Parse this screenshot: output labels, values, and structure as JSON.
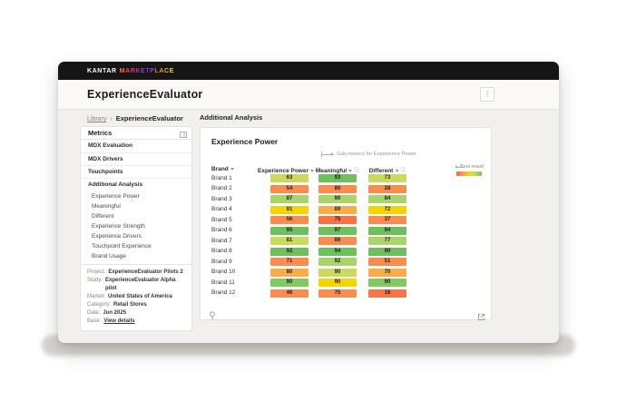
{
  "header": {
    "logo_kantar": "KANTAR",
    "logo_marketplace": "MARKETPLACE",
    "marketplace_letter_colors": [
      "#ff7033",
      "#fc4d3d",
      "#f1297c",
      "#cb2fa4",
      "#9c3ccd",
      "#6f46d8",
      "#8e44c8",
      "#e2772f",
      "#f1961f",
      "#f7b513",
      "#fcd305"
    ],
    "app_title": "ExperienceEvaluator"
  },
  "breadcrumb": {
    "library": "Library",
    "separator": "›",
    "current": "ExperienceEvaluator"
  },
  "section_title": "Additional Analysis",
  "sidebar": {
    "title": "Metrics",
    "items": [
      "MDX Evaluation",
      "MDX Drivers",
      "Touchpoints",
      "Additional Analysis"
    ],
    "active_item": "Additional Analysis",
    "sub_items": [
      "Experience Power",
      "Meaningful",
      "Different",
      "Experience Strength",
      "Experience Drivers",
      "Touchpoint Experience",
      "Brand Usage"
    ]
  },
  "project_info": [
    {
      "label": "Project:",
      "value": "ExperienceEvaluator Pilots 2",
      "is_link": false
    },
    {
      "label": "Study:",
      "value": "ExperienceEvaluator Alpha pilot",
      "is_link": false
    },
    {
      "label": "Market:",
      "value": "United States of America",
      "is_link": false
    },
    {
      "label": "Category:",
      "value": "Retail Stores",
      "is_link": false
    },
    {
      "label": "Date:",
      "value": "Jun 2025",
      "is_link": false
    },
    {
      "label": "Base:",
      "value": "View details",
      "is_link": true
    }
  ],
  "card": {
    "title": "Experience Power",
    "note": "Sub-metrics for Experience Power",
    "legend_label": "Best result",
    "menu_icon": "kebab-menu",
    "info_icon_glyph": "ⓘ"
  },
  "chart_data": {
    "type": "heatmap",
    "columns": [
      {
        "label": "Brand",
        "sortable": true,
        "info": false
      },
      {
        "label": "Experience Power",
        "sortable": true,
        "info": true
      },
      {
        "label": "Meaningful",
        "sortable": true,
        "info": true
      },
      {
        "label": "Different",
        "sortable": true,
        "info": true
      }
    ],
    "palette": {
      "g": "#6fbf5f",
      "g2": "#83c963",
      "lg": "#a9d46b",
      "yg": "#ccd95f",
      "y": "#f3d500",
      "am": "#f9ad49",
      "o": "#f98d50",
      "o2": "#f77446"
    },
    "legend_gradient": [
      "#f55f43",
      "#f98d50",
      "#f9ad49",
      "#f3d500",
      "#ccd95f",
      "#a9d46b",
      "#6fbf5f"
    ],
    "rows": [
      {
        "brand": "Brand 1",
        "values": [
          63,
          93,
          73
        ],
        "colors": [
          "yg",
          "g",
          "yg"
        ]
      },
      {
        "brand": "Brand 2",
        "values": [
          54,
          80,
          28
        ],
        "colors": [
          "o",
          "o",
          "o"
        ]
      },
      {
        "brand": "Brand 3",
        "values": [
          87,
          90,
          84
        ],
        "colors": [
          "lg",
          "lg",
          "lg"
        ]
      },
      {
        "brand": "Brand 4",
        "values": [
          81,
          89,
          72
        ],
        "colors": [
          "y",
          "am",
          "y"
        ]
      },
      {
        "brand": "Brand 5",
        "values": [
          56,
          75,
          37
        ],
        "colors": [
          "o",
          "o2",
          "o"
        ]
      },
      {
        "brand": "Brand 6",
        "values": [
          95,
          97,
          94
        ],
        "colors": [
          "g",
          "g",
          "g"
        ]
      },
      {
        "brand": "Brand 7",
        "values": [
          81,
          86,
          77
        ],
        "colors": [
          "yg",
          "o",
          "lg"
        ]
      },
      {
        "brand": "Brand 8",
        "values": [
          92,
          94,
          90
        ],
        "colors": [
          "g",
          "g",
          "g"
        ]
      },
      {
        "brand": "Brand 9",
        "values": [
          71,
          92,
          51
        ],
        "colors": [
          "o",
          "lg",
          "o"
        ]
      },
      {
        "brand": "Brand 10",
        "values": [
          80,
          90,
          70
        ],
        "colors": [
          "am",
          "yg",
          "am"
        ]
      },
      {
        "brand": "Brand 11",
        "values": [
          90,
          90,
          90
        ],
        "colors": [
          "g2",
          "y",
          "g2"
        ]
      },
      {
        "brand": "Brand 12",
        "values": [
          46,
          75,
          16
        ],
        "colors": [
          "o",
          "o",
          "o2"
        ]
      }
    ]
  }
}
